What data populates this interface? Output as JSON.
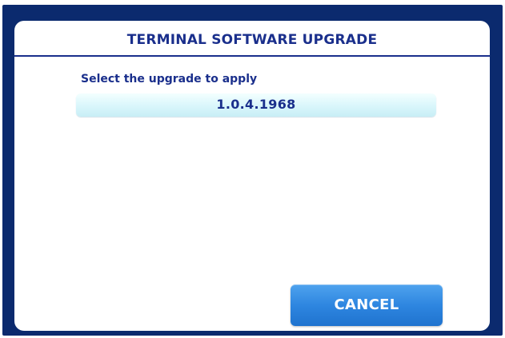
{
  "dialog": {
    "title": "TERMINAL SOFTWARE UPGRADE",
    "prompt": "Select the upgrade to apply",
    "options": [
      {
        "label": "1.0.4.1968"
      }
    ],
    "cancel_label": "CANCEL"
  },
  "colors": {
    "frame": "#0b2a6e",
    "text_primary": "#1a2f8c",
    "option_background": "#d9f6fb",
    "button_background": "#2e86e0",
    "button_text": "#ffffff"
  }
}
